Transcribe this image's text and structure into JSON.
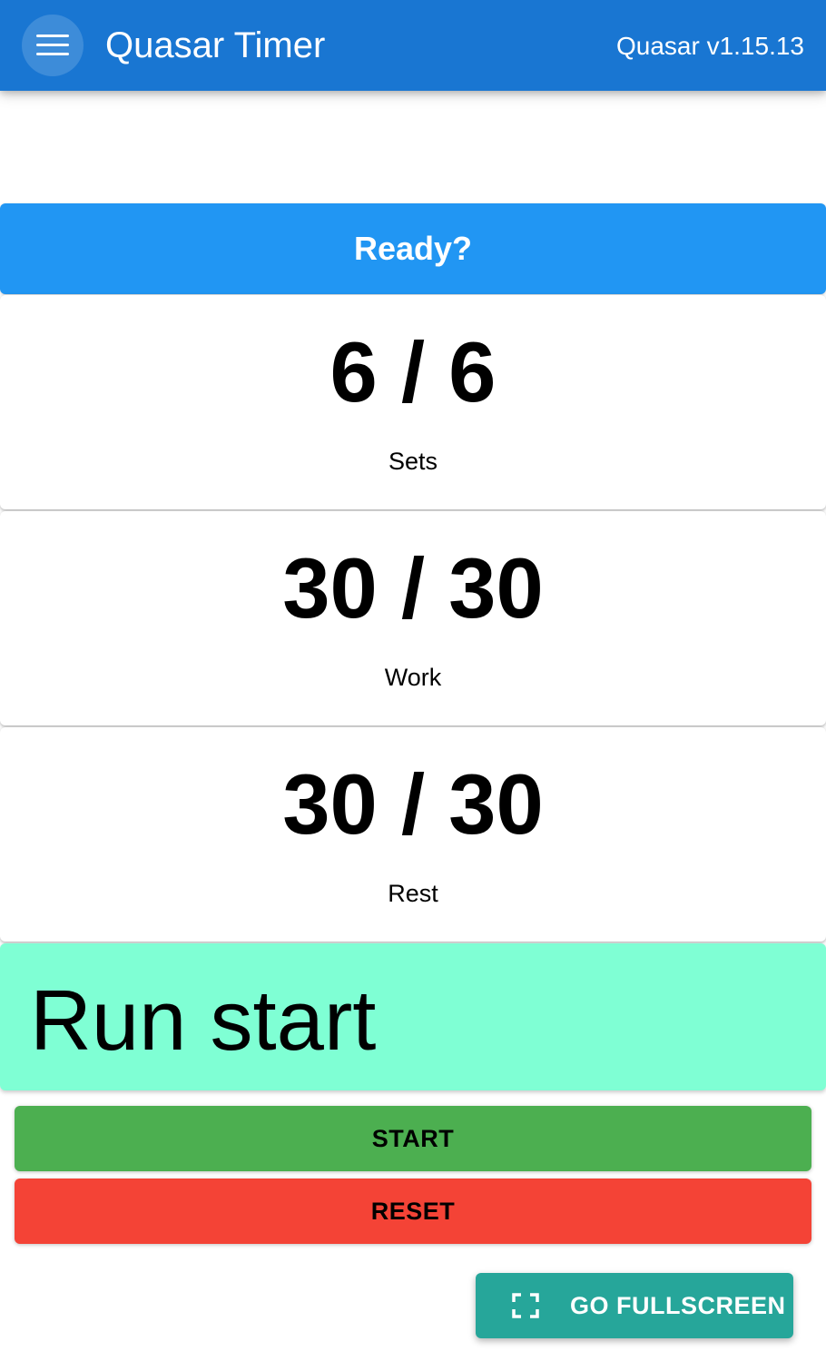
{
  "header": {
    "menu_icon": "hamburger-menu-icon",
    "title": "Quasar Timer",
    "version": "Quasar v1.15.13",
    "color": "#1976d2"
  },
  "status": {
    "text": "Ready?",
    "color": "#2196f3"
  },
  "counters": {
    "sets": {
      "value": "6 / 6",
      "label": "Sets"
    },
    "work": {
      "value": "30 / 30",
      "label": "Work"
    },
    "rest": {
      "value": "30 / 30",
      "label": "Rest"
    }
  },
  "message": {
    "text": "Run start",
    "color": "#7fffd4"
  },
  "actions": {
    "start_label": "START",
    "start_color": "#4caf50",
    "reset_label": "RESET",
    "reset_color": "#f44336"
  },
  "fullscreen": {
    "icon": "fullscreen-icon",
    "label": "GO FULLSCREEN",
    "color": "#26a69a"
  }
}
